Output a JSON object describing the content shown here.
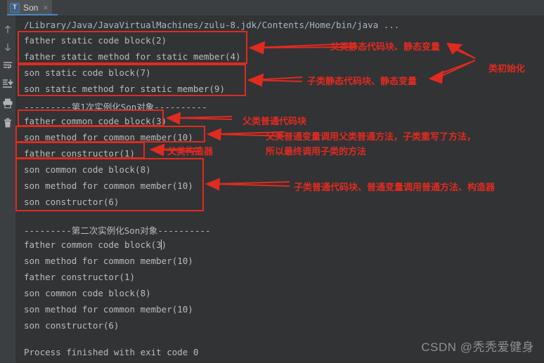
{
  "window": {
    "tab": {
      "label": "Son",
      "close_label": "×",
      "icon": "run-config-class-icon"
    }
  },
  "left_toolbar": {
    "items": [
      {
        "name": "up-arrow-icon",
        "label": "Previous occurrence"
      },
      {
        "name": "down-arrow-icon",
        "label": "Next occurrence"
      },
      {
        "name": "soft-wrap-icon",
        "label": "Soft-Wrap"
      },
      {
        "name": "scroll-to-end-icon",
        "label": "Scroll to end"
      },
      {
        "name": "print-icon",
        "label": "Print"
      },
      {
        "name": "trash-icon",
        "label": "Clear all"
      }
    ]
  },
  "console": {
    "command_path": "/Library/Java/JavaVirtualMachines/zulu-8.jdk/Contents/Home/bin/java ...",
    "lines": [
      "father static code block(2)",
      "father static method for static member(4)",
      "son static code block(7)",
      "son static method for static member(9)",
      "---------第1次实例化Son对象----------",
      "father common code block(3)",
      "son method for common member(10)",
      "father constructor(1)",
      "son common code block(8)",
      "son method for common member(10)",
      "son constructor(6)",
      "",
      "---------第二次实例化Son对象----------",
      "father common code block(3)",
      "son method for common member(10)",
      "father constructor(1)",
      "son common code block(8)",
      "son method for common member(10)",
      "son constructor(6)",
      "",
      "Process finished with exit code 0"
    ]
  },
  "annotations": {
    "accent_color": "#e02b20",
    "labels": [
      {
        "id": "a1",
        "text": "父类静态代码块、静态变量"
      },
      {
        "id": "a2",
        "text": "类初始化"
      },
      {
        "id": "a3",
        "text": "子类静态代码块、静态变量"
      },
      {
        "id": "a4",
        "text": "父类普通代码块"
      },
      {
        "id": "a5",
        "text": "父类普通变量调用父类普通方法，子类重写了方法，"
      },
      {
        "id": "a6",
        "text": "所以最终调用子类的方法"
      },
      {
        "id": "a7",
        "text": "父类构造器"
      },
      {
        "id": "a8",
        "text": "子类普通代码块、普通变量调用普通方法、构造器"
      }
    ]
  },
  "watermark": {
    "text": "CSDN @秃秃爱健身"
  }
}
